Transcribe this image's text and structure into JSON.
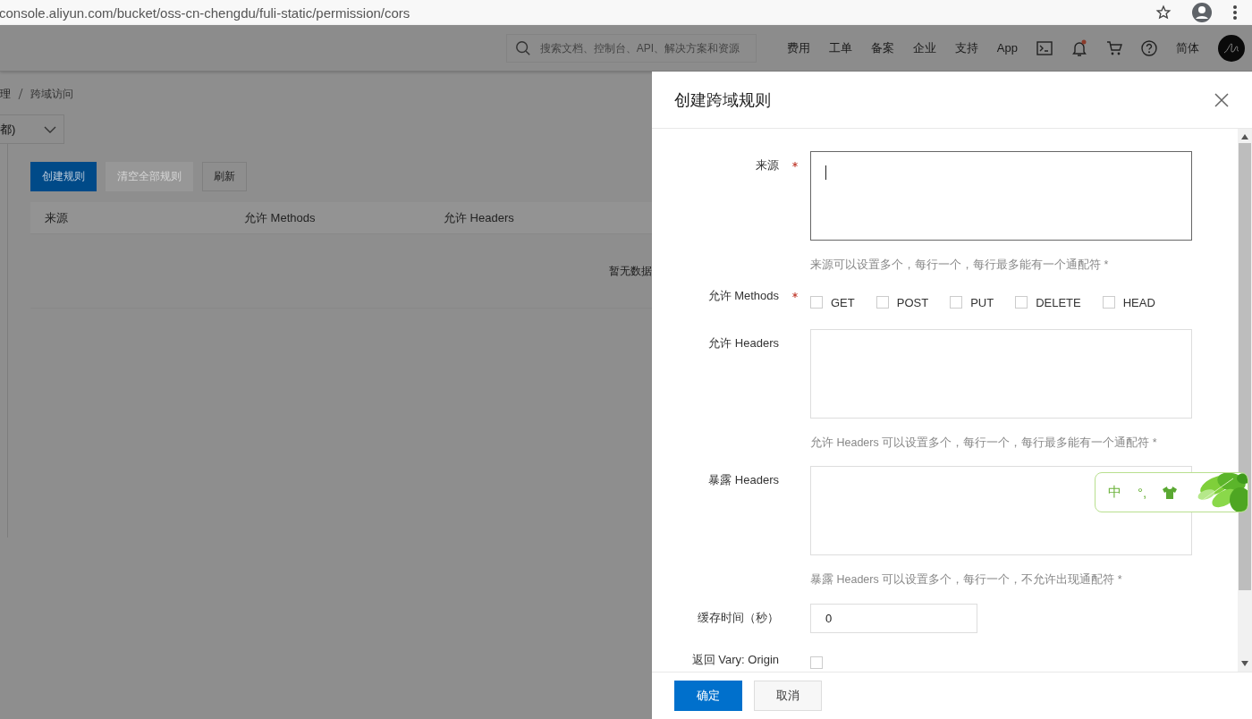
{
  "browser": {
    "url": "console.aliyun.com/bucket/oss-cn-chengdu/fuli-static/permission/cors"
  },
  "topbar": {
    "search": {
      "placeholder": "搜索文档、控制台、API、解决方案和资源"
    },
    "nav": [
      "费用",
      "工单",
      "备案",
      "企业",
      "支持",
      "App"
    ],
    "notification_dot": true,
    "language": "简体"
  },
  "breadcrumb": [
    "理",
    "跨域访问"
  ],
  "region_select": {
    "value": "都)"
  },
  "toolbar": [
    {
      "label": "创建规则",
      "kind": "primary",
      "disabled": false
    },
    {
      "label": "清空全部规则",
      "kind": "default",
      "disabled": true
    },
    {
      "label": "刷新",
      "kind": "default",
      "disabled": false
    }
  ],
  "table": {
    "columns": [
      "来源",
      "允许 Methods",
      "允许 Headers"
    ],
    "empty_text": "暂无数据"
  },
  "drawer": {
    "title": "创建跨域规则",
    "fields": [
      {
        "kind": "textarea",
        "label": "来源",
        "required": true,
        "focused": true,
        "help": "来源可以设置多个，每行一个，每行最多能有一个通配符 *"
      },
      {
        "kind": "checkboxes",
        "label": "允许 Methods",
        "required": true,
        "options": [
          {
            "label": "GET",
            "checked": false
          },
          {
            "label": "POST",
            "checked": false
          },
          {
            "label": "PUT",
            "checked": false
          },
          {
            "label": "DELETE",
            "checked": false
          },
          {
            "label": "HEAD",
            "checked": false
          }
        ]
      },
      {
        "kind": "textarea",
        "label": "允许 Headers",
        "required": false,
        "focused": false,
        "help": "允许 Headers 可以设置多个，每行一个，每行最多能有一个通配符 *"
      },
      {
        "kind": "textarea",
        "label": "暴露 Headers",
        "required": false,
        "focused": false,
        "help": "暴露 Headers 可以设置多个，每行一个，不允许出现通配符 *"
      },
      {
        "kind": "input",
        "label": "缓存时间（秒）",
        "required": false,
        "value": "0"
      },
      {
        "kind": "checkbox",
        "label": "返回 Vary: Origin",
        "required": false,
        "checked": false
      }
    ],
    "buttons": [
      {
        "label": "确定",
        "kind": "primary"
      },
      {
        "label": "取消",
        "kind": "default"
      }
    ]
  },
  "ime_toolbar": {
    "mode": "中",
    "punctuation": "°,"
  }
}
